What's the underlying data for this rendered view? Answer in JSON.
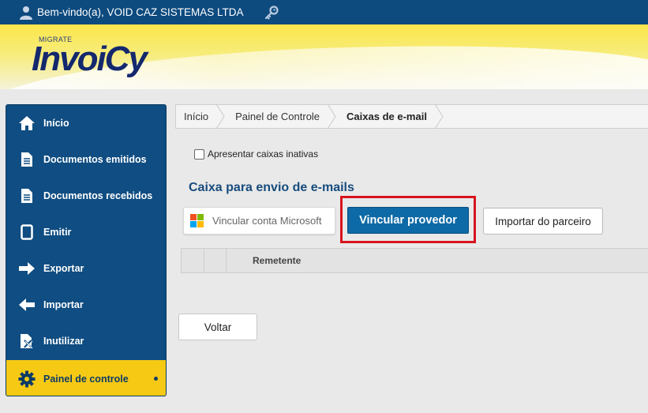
{
  "topbar": {
    "welcome": "Bem-vindo(a), VOID CAZ SISTEMAS LTDA",
    "user_icon": "user-icon",
    "key_icon": "key-icon"
  },
  "logo": {
    "sub": "MIGRATE",
    "main": "InvoiCy"
  },
  "sidebar": {
    "items": [
      {
        "label": "Início",
        "icon": "home-icon"
      },
      {
        "label": "Documentos emitidos",
        "icon": "document-icon"
      },
      {
        "label": "Documentos recebidos",
        "icon": "document-icon"
      },
      {
        "label": "Emitir",
        "icon": "tablet-icon"
      },
      {
        "label": "Exportar",
        "icon": "arrow-right-icon"
      },
      {
        "label": "Importar",
        "icon": "arrow-left-icon"
      },
      {
        "label": "Inutilizar",
        "icon": "document-x-icon"
      },
      {
        "label": "Painel de controle",
        "icon": "gear-icon",
        "active": true
      }
    ]
  },
  "breadcrumb": [
    "Início",
    "Painel de Controle",
    "Caixas de e-mail"
  ],
  "filter": {
    "show_inactive_label": "Apresentar caixas inativas",
    "checked": false
  },
  "section": {
    "title": "Caixa para envio de e-mails"
  },
  "buttons": {
    "microsoft": "Vincular conta Microsoft",
    "provider": "Vincular provedor",
    "import_partner": "Importar do parceiro",
    "back": "Voltar"
  },
  "table": {
    "columns": [
      "",
      "",
      "Remetente"
    ]
  },
  "colors": {
    "topbar": "#0d4a7e",
    "sidebar": "#0f4d82",
    "sidebar_active": "#f6c915",
    "primary_button": "#0e6aa6",
    "highlight_box": "#d7141e",
    "section_title": "#174c7d"
  }
}
